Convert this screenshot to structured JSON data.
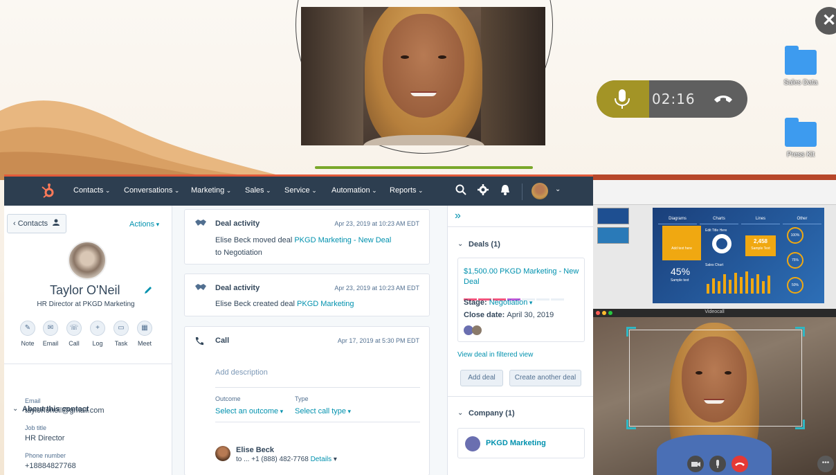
{
  "desktop": {
    "icons": [
      {
        "label": "Sales Data",
        "icon": "folder-icon"
      },
      {
        "label": "Press Kit",
        "icon": "folder-icon"
      }
    ]
  },
  "call_widget": {
    "timer": "02:16",
    "mic_icon": "microphone-icon",
    "end_icon": "phone-hangup-icon",
    "mic_color": "#a39426"
  },
  "hubspot": {
    "accent": "#e25a3a",
    "nav": {
      "items": [
        "Contacts",
        "Conversations",
        "Marketing",
        "Sales",
        "Service",
        "Automation",
        "Reports"
      ]
    },
    "contact": {
      "back_label": "Contacts",
      "actions_label": "Actions",
      "name": "Taylor O'Neil",
      "title": "HR Director at PKGD Marketing",
      "quick_actions": [
        "Note",
        "Email",
        "Call",
        "Log",
        "Task",
        "Meet"
      ],
      "about_title": "About this contact",
      "fields": [
        {
          "label": "Email",
          "value": "taylorfoneil@gmail.com"
        },
        {
          "label": "Job title",
          "value": "HR Director"
        },
        {
          "label": "Phone number",
          "value": "+18884827768"
        }
      ]
    },
    "timeline": {
      "activity1": {
        "title": "Deal activity",
        "date": "Apr 23, 2019 at 10:23 AM EDT",
        "text_before": "Elise Beck moved deal ",
        "link": "PKGD Marketing - New Deal",
        "text_after": " to Negotiation"
      },
      "activity2": {
        "title": "Deal activity",
        "date": "Apr 23, 2019 at 10:23 AM EDT",
        "text_before": "Elise Beck created deal ",
        "link": "PKGD Marketing"
      },
      "call": {
        "title": "Call",
        "date": "Apr 17, 2019 at 5:30 PM EDT",
        "description_placeholder": "Add description",
        "outcome_label": "Outcome",
        "outcome_value": "Select an outcome",
        "type_label": "Type",
        "type_value": "Select call type",
        "caller_name": "Elise Beck",
        "caller_to": "to ... +1 (888) 482-7768",
        "details_label": "Details"
      }
    },
    "sidebar": {
      "collapse": "»",
      "deals_title": "Deals (1)",
      "deal": {
        "name": "$1,500.00 PKGD Marketing - New Deal",
        "stage_label": "Stage:",
        "stage_value": "Negotiation",
        "close_label": "Close date:",
        "close_value": "April 30, 2019"
      },
      "view_link": "View deal in filtered view",
      "add_deal": "Add deal",
      "create_deal": "Create another deal",
      "company_title": "Company (1)",
      "company_name": "PKGD Marketing"
    }
  },
  "presentation": {
    "columns": [
      "Diagrams",
      "Charts",
      "Lines",
      "Other"
    ],
    "box_text": "Add text here",
    "big_percent": "45%",
    "big_percent_note": "Sample text",
    "stat_value": "2,458",
    "stat_note": "Sample Text",
    "title_here": "Edit Title Here",
    "sales_chart": "Sales Chart",
    "rings": [
      "100%",
      "75%",
      "50%"
    ]
  },
  "videocall": {
    "title": "Videocall",
    "accent": "#2fb7c4"
  }
}
